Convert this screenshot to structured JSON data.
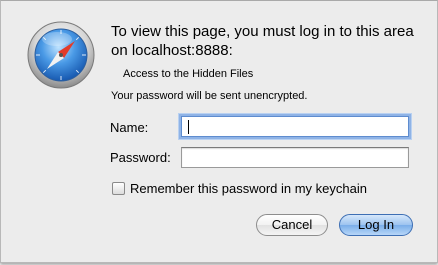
{
  "dialog": {
    "message": "To view this page, you must log in to this area on localhost:8888:",
    "realm": "Access to the Hidden Files",
    "warning": "Your password will be sent unencrypted.",
    "icon": "safari-compass-icon"
  },
  "form": {
    "name_label": "Name:",
    "name_value": "",
    "password_label": "Password:",
    "password_value": "",
    "remember_label": "Remember this password in my keychain",
    "remember_checked": false
  },
  "buttons": {
    "cancel_label": "Cancel",
    "login_label": "Log In"
  },
  "colors": {
    "dialog_background": "#ececec",
    "focus_ring": "#8fb3e6",
    "default_button": "#7aaee9"
  }
}
